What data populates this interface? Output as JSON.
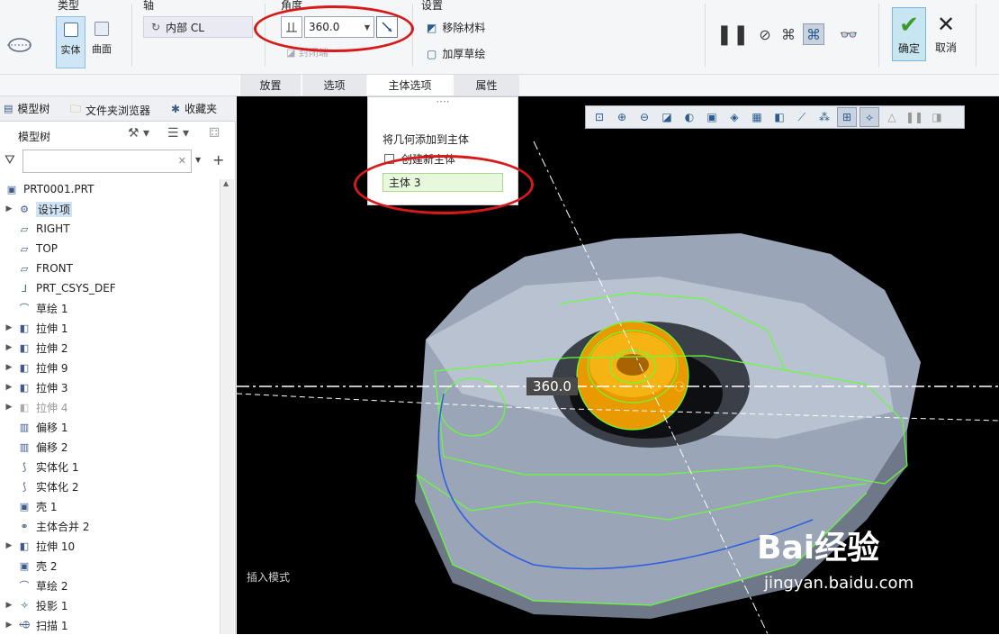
{
  "ribbon": {
    "type": {
      "title": "类型",
      "solid": "实体",
      "surface": "曲面"
    },
    "axis": {
      "title": "轴",
      "value": "内部 CL"
    },
    "angle": {
      "title": "角度",
      "value": "360.0",
      "closed_ends": "封闭端"
    },
    "settings": {
      "title": "设置",
      "remove_material": "移除材料",
      "thicken_sketch": "加厚草绘"
    },
    "ok": "确定",
    "cancel": "取消"
  },
  "tabs": [
    "放置",
    "选项",
    "主体选项",
    "属性"
  ],
  "active_tab": "主体选项",
  "left_panel": {
    "tabs": [
      "模型树",
      "文件夹浏览器",
      "收藏夹"
    ],
    "header": "模型树",
    "filter_placeholder": "",
    "root": "PRT0001.PRT",
    "items": [
      {
        "label": "设计项",
        "icon": "design-item-icon",
        "expandable": true,
        "selected": true
      },
      {
        "label": "RIGHT",
        "icon": "datum-plane-icon",
        "expandable": false
      },
      {
        "label": "TOP",
        "icon": "datum-plane-icon",
        "expandable": false
      },
      {
        "label": "FRONT",
        "icon": "datum-plane-icon",
        "expandable": false
      },
      {
        "label": "PRT_CSYS_DEF",
        "icon": "csys-icon",
        "expandable": false
      },
      {
        "label": "草绘 1",
        "icon": "sketch-icon",
        "expandable": false
      },
      {
        "label": "拉伸 1",
        "icon": "extrude-icon",
        "expandable": true
      },
      {
        "label": "拉伸 2",
        "icon": "extrude-icon",
        "expandable": true
      },
      {
        "label": "拉伸 9",
        "icon": "extrude-icon",
        "expandable": true
      },
      {
        "label": "拉伸 3",
        "icon": "extrude-icon",
        "expandable": true
      },
      {
        "label": "拉伸 4",
        "icon": "extrude-icon",
        "expandable": true,
        "dim": true
      },
      {
        "label": "偏移 1",
        "icon": "offset-icon",
        "expandable": false
      },
      {
        "label": "偏移 2",
        "icon": "offset-icon",
        "expandable": false
      },
      {
        "label": "实体化 1",
        "icon": "solidify-icon",
        "expandable": false
      },
      {
        "label": "实体化 2",
        "icon": "solidify-icon",
        "expandable": false
      },
      {
        "label": "壳 1",
        "icon": "shell-icon",
        "expandable": false
      },
      {
        "label": "主体合并 2",
        "icon": "body-merge-icon",
        "expandable": false
      },
      {
        "label": "拉伸 10",
        "icon": "extrude-icon",
        "expandable": true
      },
      {
        "label": "壳 2",
        "icon": "shell-icon",
        "expandable": false
      },
      {
        "label": "草绘 2",
        "icon": "sketch-icon",
        "expandable": false
      },
      {
        "label": "投影 1",
        "icon": "project-icon",
        "expandable": true
      },
      {
        "label": "扫描 1",
        "icon": "sweep-icon",
        "expandable": true
      }
    ]
  },
  "body_popup": {
    "title": "将几何添加到主体",
    "create_new_body": "创建新主体",
    "body": "主体 3"
  },
  "canvas": {
    "insert_mode": "插入模式",
    "angle_tag": "360.0",
    "watermark_brand": "Bai经验",
    "watermark_url": "jingyan.baidu.com"
  },
  "colors": {
    "highlight_ring": "#d61a1a",
    "selection_green": "#66ff33",
    "part_gray": "#9aa5b8",
    "part_orange": "#f0a000"
  }
}
